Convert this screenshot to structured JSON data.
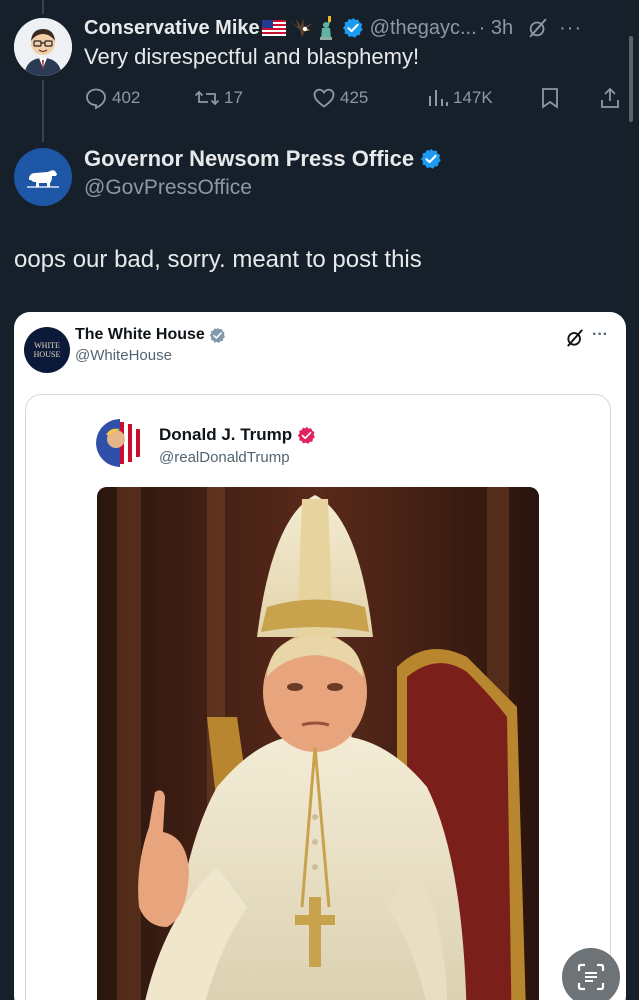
{
  "reply": {
    "name": "Conservative Mike",
    "emoji": [
      "us-flag-emoji",
      "eagle-emoji",
      "statue-of-liberty-emoji"
    ],
    "handle": "@thegayc...",
    "time": "· 3h",
    "text": "Very disrespectful and blasphemy!",
    "stats": {
      "replies": "402",
      "reposts": "17",
      "likes": "425",
      "views": "147K"
    }
  },
  "main": {
    "name": "Governor Newsom Press Office",
    "handle": "@GovPressOffice",
    "text": "oops our bad, sorry. meant to post this"
  },
  "embed": {
    "author_name": "The White House",
    "author_handle": "@WhiteHouse",
    "author_avatar_text": "WHITE HOUSE",
    "more": "···",
    "quoted": {
      "name": "Donald J. Trump",
      "handle": "@realDonaldTrump",
      "image": "pope-figure-photo"
    }
  },
  "colors": {
    "background": "#15202b",
    "text": "#e7e9ea",
    "muted": "#8b98a5",
    "verified_blue": "#1d9bf0",
    "verified_red": "#e0245e"
  }
}
